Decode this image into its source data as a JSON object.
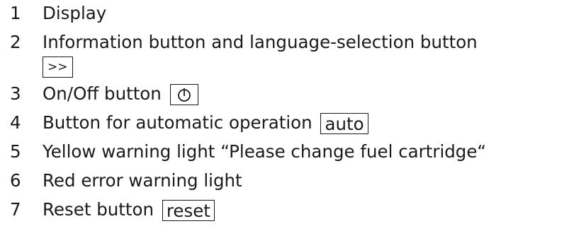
{
  "legend": {
    "items": [
      {
        "number": "1",
        "text": "Display"
      },
      {
        "number": "2",
        "text": "Information button and language-selection button",
        "key": ">>"
      },
      {
        "number": "3",
        "text": "On/Off button",
        "key_icon": "power-icon"
      },
      {
        "number": "4",
        "text": "Button for automatic operation",
        "key": "auto"
      },
      {
        "number": "5",
        "text": "Yellow warning light “Please change fuel cartridge“"
      },
      {
        "number": "6",
        "text": "Red error warning light"
      },
      {
        "number": "7",
        "text": "Reset button",
        "key": "reset"
      }
    ]
  }
}
